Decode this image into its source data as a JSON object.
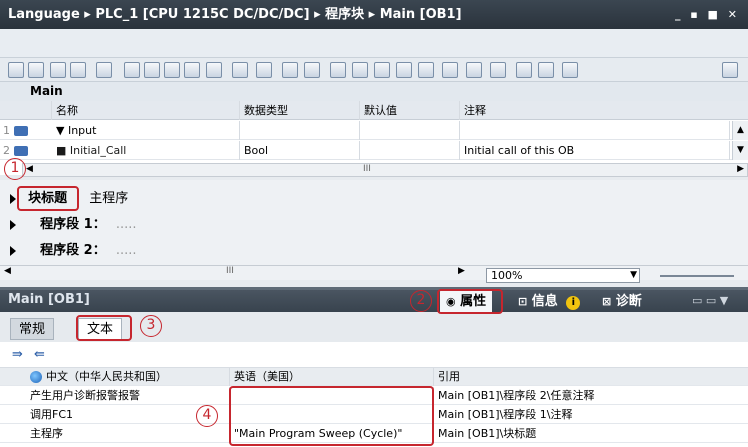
{
  "titlebar": {
    "path": "Language ▸ PLC_1 [CPU 1215C DC/DC/DC] ▸ 程序块 ▸ Main [OB1]",
    "controls": "_ ▪ ■ ✕"
  },
  "block_name": "Main",
  "interface": {
    "headers": [
      "名称",
      "数据类型",
      "默认值",
      "注释"
    ],
    "rows": [
      {
        "num": "1",
        "name": "▼ Input",
        "type": "",
        "default": "",
        "comment": ""
      },
      {
        "num": "2",
        "name": "■    Initial_Call",
        "type": "Bool",
        "default": "",
        "comment": "Initial call of this OB"
      }
    ],
    "scroll_mark": "III"
  },
  "blocks": {
    "title_label": "块标题",
    "title_value": "主程序",
    "networks": [
      {
        "label": "程序段 1：",
        "value": "....."
      },
      {
        "label": "程序段 2：",
        "value": "....."
      }
    ],
    "scroll_mark": "III",
    "zoom": "100%"
  },
  "inspector": {
    "title": "Main [OB1]",
    "tabs": [
      "属性",
      "信息",
      "诊断"
    ],
    "info_badge": "i",
    "subtabs": [
      "常规",
      "文本"
    ]
  },
  "texts": {
    "headers": [
      "中文（中华人民共和国）",
      "英语（美国）",
      "引用"
    ],
    "rows": [
      {
        "zh": "产生用户诊断报警报警",
        "en": "",
        "ref": "Main [OB1]\\程序段 2\\任意注释"
      },
      {
        "zh": "调用FC1",
        "en": "",
        "ref": "Main [OB1]\\程序段 1\\注释"
      },
      {
        "zh": "主程序",
        "en": "\"Main Program Sweep (Cycle)\"",
        "ref": "Main [OB1]\\块标题"
      }
    ]
  },
  "callouts": [
    "1",
    "2",
    "3",
    "4"
  ],
  "colors": {
    "title_bar": "#2f3a45",
    "highlight": "#c6262e",
    "accent": "#3f6fb4"
  }
}
